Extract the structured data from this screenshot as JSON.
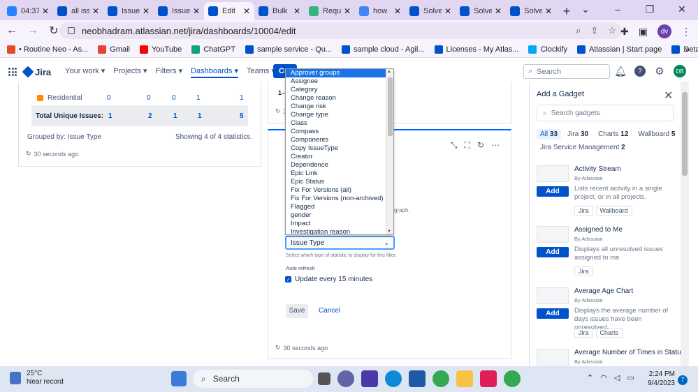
{
  "browser": {
    "tabs": [
      {
        "title": "04:37",
        "color": "#2684ff",
        "active": false
      },
      {
        "title": "all iss",
        "color": "#0052cc",
        "active": false
      },
      {
        "title": "Issue",
        "color": "#0052cc",
        "active": false
      },
      {
        "title": "Issue",
        "color": "#0052cc",
        "active": false
      },
      {
        "title": "Edit",
        "color": "#0052cc",
        "active": true
      },
      {
        "title": "Bulk",
        "color": "#0052cc",
        "active": false
      },
      {
        "title": "Requ",
        "color": "#36b37e",
        "active": false
      },
      {
        "title": "how",
        "color": "#4285f4",
        "active": false
      },
      {
        "title": "Solve",
        "color": "#0052cc",
        "active": false
      },
      {
        "title": "Solve",
        "color": "#0052cc",
        "active": false
      },
      {
        "title": "Solve",
        "color": "#0052cc",
        "active": false
      }
    ],
    "url": "neobhadram.atlassian.net/jira/dashboards/10004/edit",
    "profile_initials": "dv",
    "bookmarks": [
      {
        "label": "• Routine Neo - As...",
        "color": "#e34c26"
      },
      {
        "label": "Gmail",
        "color": "#ea4335"
      },
      {
        "label": "YouTube",
        "color": "#ff0000"
      },
      {
        "label": "ChatGPT",
        "color": "#10a37f"
      },
      {
        "label": "sample service - Qu...",
        "color": "#0052cc"
      },
      {
        "label": "sample cloud - Agil...",
        "color": "#0052cc"
      },
      {
        "label": "Licenses - My Atlas...",
        "color": "#0052cc"
      },
      {
        "label": "Clockify",
        "color": "#03a9f4"
      },
      {
        "label": "Atlassian | Start page",
        "color": "#0052cc"
      },
      {
        "label": "Details - Jira",
        "color": "#0052cc"
      }
    ],
    "bookmarks_more": "»"
  },
  "jira": {
    "product": "Jira",
    "nav": [
      "Your work ▾",
      "Projects ▾",
      "Filters ▾",
      "Dashboards ▾",
      "Teams ▾",
      "Apps ▾"
    ],
    "selected_nav": 3,
    "create_label": "Cre",
    "search_placeholder": "Search",
    "user_initials": "DB"
  },
  "left_gadget": {
    "row_label": "Residential",
    "row_values": [
      "0",
      "0",
      "0",
      "1",
      "1"
    ],
    "total_label": "Total Unique Issues:",
    "total_values": [
      "1",
      "2",
      "1",
      "1",
      "5"
    ],
    "grouped_by": "Grouped by: Issue Type",
    "showing": "Showing 4 of 4 statistics.",
    "updated": "30 seconds ago"
  },
  "middle_top": {
    "range_text": "1–5",
    "refresh_text": "3"
  },
  "edit_gadget": {
    "graph_text": "graph.",
    "statistic_value": "Issue Type",
    "statistic_help": "Select which type of statistic to display for this filter.",
    "auto_refresh_label": "Auto refresh",
    "auto_refresh_option": "Update every 15 minutes",
    "auto_refresh_checked": true,
    "save_label": "Save",
    "cancel_label": "Cancel",
    "updated": "30 seconds ago"
  },
  "dropdown": {
    "highlighted": 0,
    "options": [
      "Approver groups",
      "Assignee",
      "Category",
      "Change reason",
      "Change risk",
      "Change type",
      "Class",
      "Compass",
      "Components",
      "Copy IssueType",
      "Creator",
      "Dependence",
      "Epic Link",
      "Epic Status",
      "Fix For Versions (all)",
      "Fix For Versions (non-archived)",
      "Flagged",
      "gender",
      "Impact",
      "Investigation reason"
    ]
  },
  "add_gadget": {
    "title": "Add a Gadget",
    "search_placeholder": "Search gadgets",
    "categories": [
      {
        "label": "All",
        "count": "33",
        "on": true
      },
      {
        "label": "Jira",
        "count": "30",
        "on": false
      },
      {
        "label": "Charts",
        "count": "12",
        "on": false
      },
      {
        "label": "Wallboard",
        "count": "5",
        "on": false
      },
      {
        "label": "Jira Service Management",
        "count": "2",
        "on": false
      }
    ],
    "add_label": "Add",
    "gadgets": [
      {
        "name": "Activity Stream",
        "by": "By Atlassian",
        "desc": "Lists recent activity in a single project, or in all projects.",
        "tags": [
          "Jira",
          "Wallboard"
        ]
      },
      {
        "name": "Assigned to Me",
        "by": "By Atlassian",
        "desc": "Displays all unresolved issues assigned to me",
        "tags": [
          "Jira"
        ]
      },
      {
        "name": "Average Age Chart",
        "by": "By Atlassian",
        "desc": "Displays the average number of days issues have been unresolved.",
        "tags": [
          "Jira",
          "Charts"
        ]
      },
      {
        "name": "Average Number of Times in Status",
        "by": "By Atlassian",
        "desc": "",
        "tags": []
      }
    ]
  },
  "taskbar": {
    "temperature": "25°C",
    "weather": "Near record",
    "search_label": "Search",
    "time": "2:24 PM",
    "date": "9/4/2023",
    "notifications": "7"
  }
}
